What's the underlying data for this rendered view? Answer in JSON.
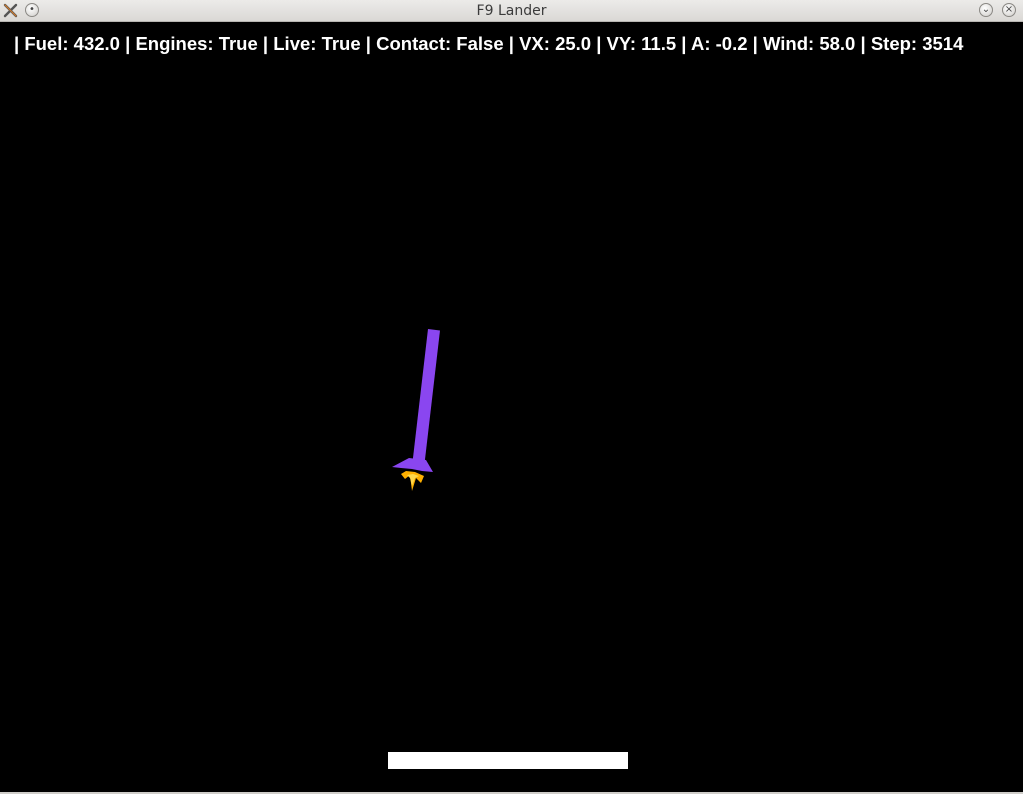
{
  "window": {
    "title": "F9 Lander"
  },
  "hud": {
    "fuel_label": "Fuel:",
    "fuel": "432.0",
    "engines_label": "Engines:",
    "engines": "True",
    "live_label": "Live:",
    "live": "True",
    "contact_label": "Contact:",
    "contact": "False",
    "vx_label": "VX:",
    "vx": "25.0",
    "vy_label": "VY:",
    "vy": "11.5",
    "a_label": "A:",
    "a": "-0.2",
    "wind_label": "Wind:",
    "wind": "58.0",
    "step_label": "Step:",
    "step": "3514"
  },
  "colors": {
    "background": "#000000",
    "rocket": "#8a46f0",
    "flame_outer": "#ffb000",
    "flame_inner": "#ffd84a",
    "pad": "#ffffff",
    "hud_text": "#ffffff"
  },
  "icons": {
    "app": "app-x-icon",
    "menu": "window-menu-icon",
    "minimize": "chevron-down-icon",
    "close": "close-icon"
  }
}
